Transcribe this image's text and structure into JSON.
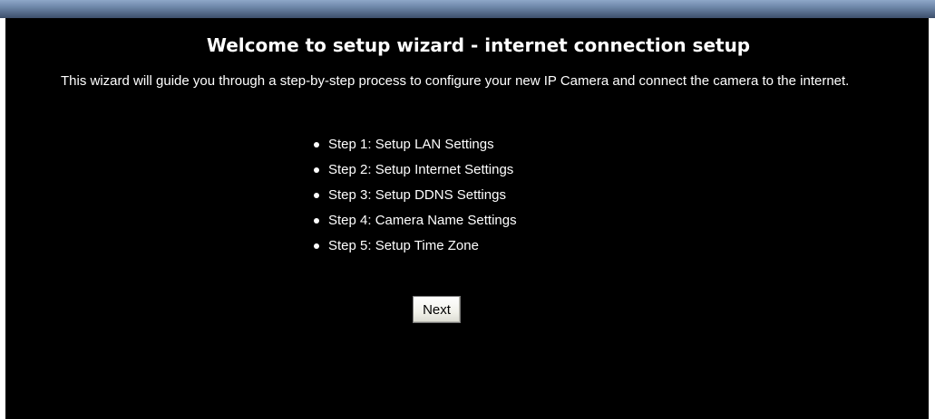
{
  "wizard": {
    "title": "Welcome to setup wizard - internet connection setup",
    "intro": "This wizard will guide you through a step-by-step process to configure your new IP Camera and connect the camera to the internet.",
    "steps": [
      "Step 1: Setup LAN Settings",
      "Step 2: Setup Internet Settings",
      "Step 3: Setup DDNS Settings",
      "Step 4: Camera Name Settings",
      "Step 5: Setup Time Zone"
    ],
    "next_label": "Next"
  },
  "colors": {
    "panel_background": "#000000",
    "text": "#ffffff",
    "top_bar": "#6d86a8"
  }
}
